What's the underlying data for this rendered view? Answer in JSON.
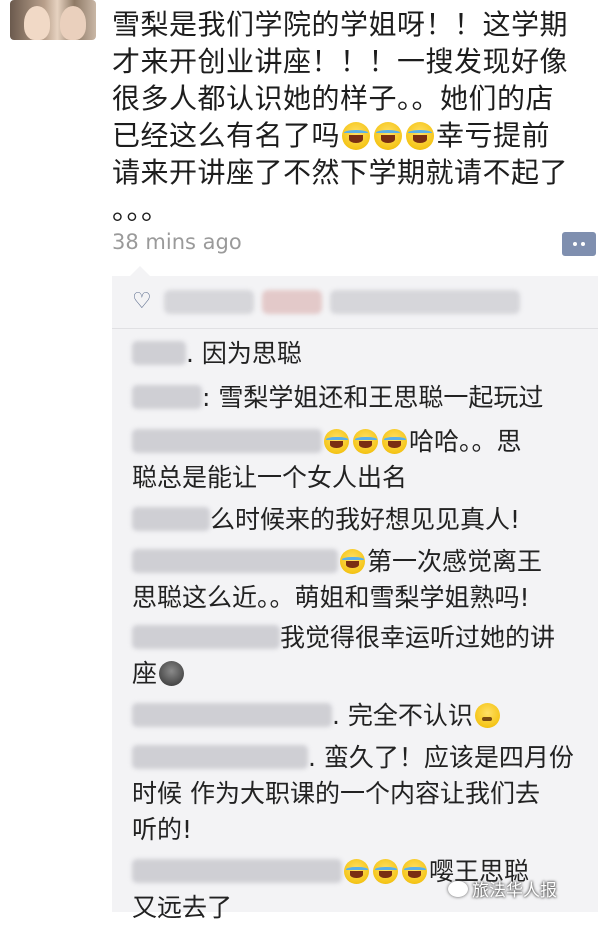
{
  "post": {
    "line1": "雪梨是我们学院的学姐呀！！这学期",
    "line2": "才来开创业讲座！！！一搜发现好像",
    "line3": "很多人都认识她的样子。。她们的店",
    "line4_a": "已经这么有名了吗",
    "line4_b": "幸亏提前",
    "line5": "请来开讲座了不然下学期就请不起了",
    "line6": "。。。",
    "timestamp": "38 mins ago"
  },
  "comments": [
    {
      "a": "因为思聪"
    },
    {
      "a": "雪梨学姐还和王思聪一起玩过"
    },
    {
      "a": "哈哈。。思",
      "b": "聪总是能让一个女人出名"
    },
    {
      "a": "么时候来的我好想见见真人!"
    },
    {
      "a": "第一次感觉离王",
      "b": "思聪这么近。。萌姐和雪梨学姐熟吗!"
    },
    {
      "a": "我觉得很幸运听过她的讲",
      "b": "座"
    },
    {
      "a": "完全不认识"
    },
    {
      "a": "蛮久了！应该是四月份",
      "b": "时候 作为大职课的一个内容让我们去",
      "c": "听的!"
    },
    {
      "a": "嘤王思聪",
      "b": "又远去了"
    }
  ],
  "watermark": "旅法华人报",
  "icons": {
    "like": "heart-icon",
    "comment": "comment-icon",
    "emoji_laugh": "tears-of-joy-emoji",
    "emoji_dark": "new-moon-face-emoji",
    "emoji_think": "thinking-emoji"
  },
  "colors": {
    "comment_bg": "#f3f3f5",
    "timestamp": "#9a9a9a",
    "comment_button": "#7f8faf"
  }
}
